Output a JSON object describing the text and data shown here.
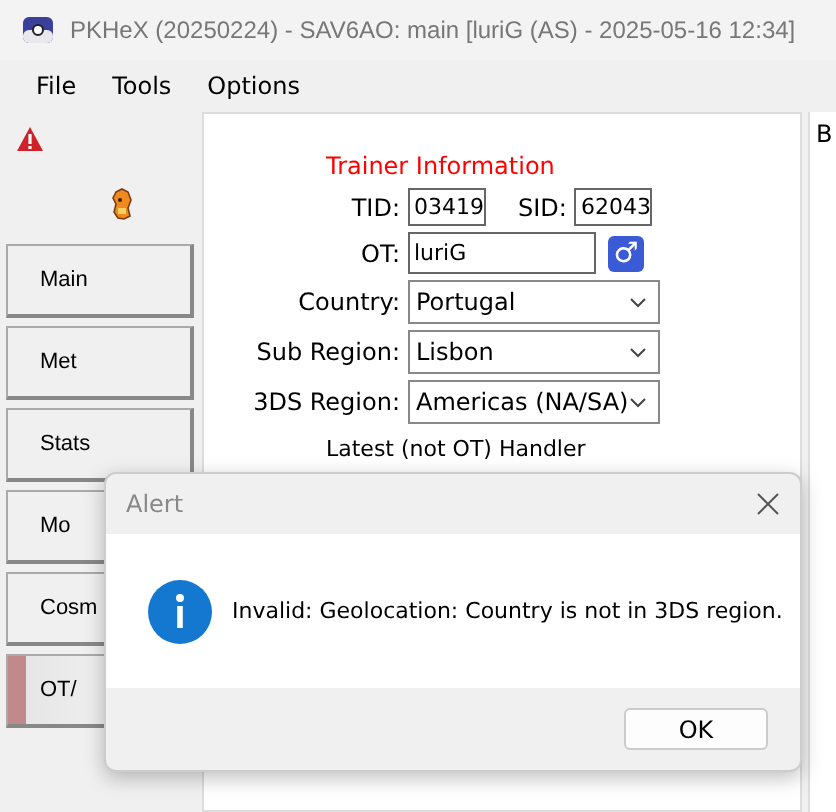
{
  "window": {
    "title": "PKHeX (20250224) - SAV6AO: main [luriG (AS) - 2025-05-16 12:34]"
  },
  "menu": [
    "File",
    "Tools",
    "Options"
  ],
  "tabs": [
    {
      "label": "Main",
      "selected": false
    },
    {
      "label": "Met",
      "selected": false
    },
    {
      "label": "Stats",
      "selected": false
    },
    {
      "label": "Mo",
      "selected": false
    },
    {
      "label": "Cosm",
      "selected": false
    },
    {
      "label": "OT/",
      "selected": true
    }
  ],
  "trainer": {
    "heading": "Trainer Information",
    "tid_label": "TID:",
    "tid": "03419",
    "sid_label": "SID:",
    "sid": "62043",
    "ot_label": "OT:",
    "ot": "luriG",
    "gender_symbol": "♂",
    "fields": [
      {
        "label": "Country:",
        "value": "Portugal"
      },
      {
        "label": "Sub Region:",
        "value": "Lisbon"
      },
      {
        "label": "3DS Region:",
        "value": "Americas (NA/SA)"
      }
    ],
    "handler_heading": "Latest (not OT) Handler"
  },
  "right_panel": {
    "text": "B"
  },
  "dialog": {
    "title": "Alert",
    "message": "Invalid: Geolocation: Country is not in 3DS region.",
    "buttons": [
      "OK"
    ]
  }
}
